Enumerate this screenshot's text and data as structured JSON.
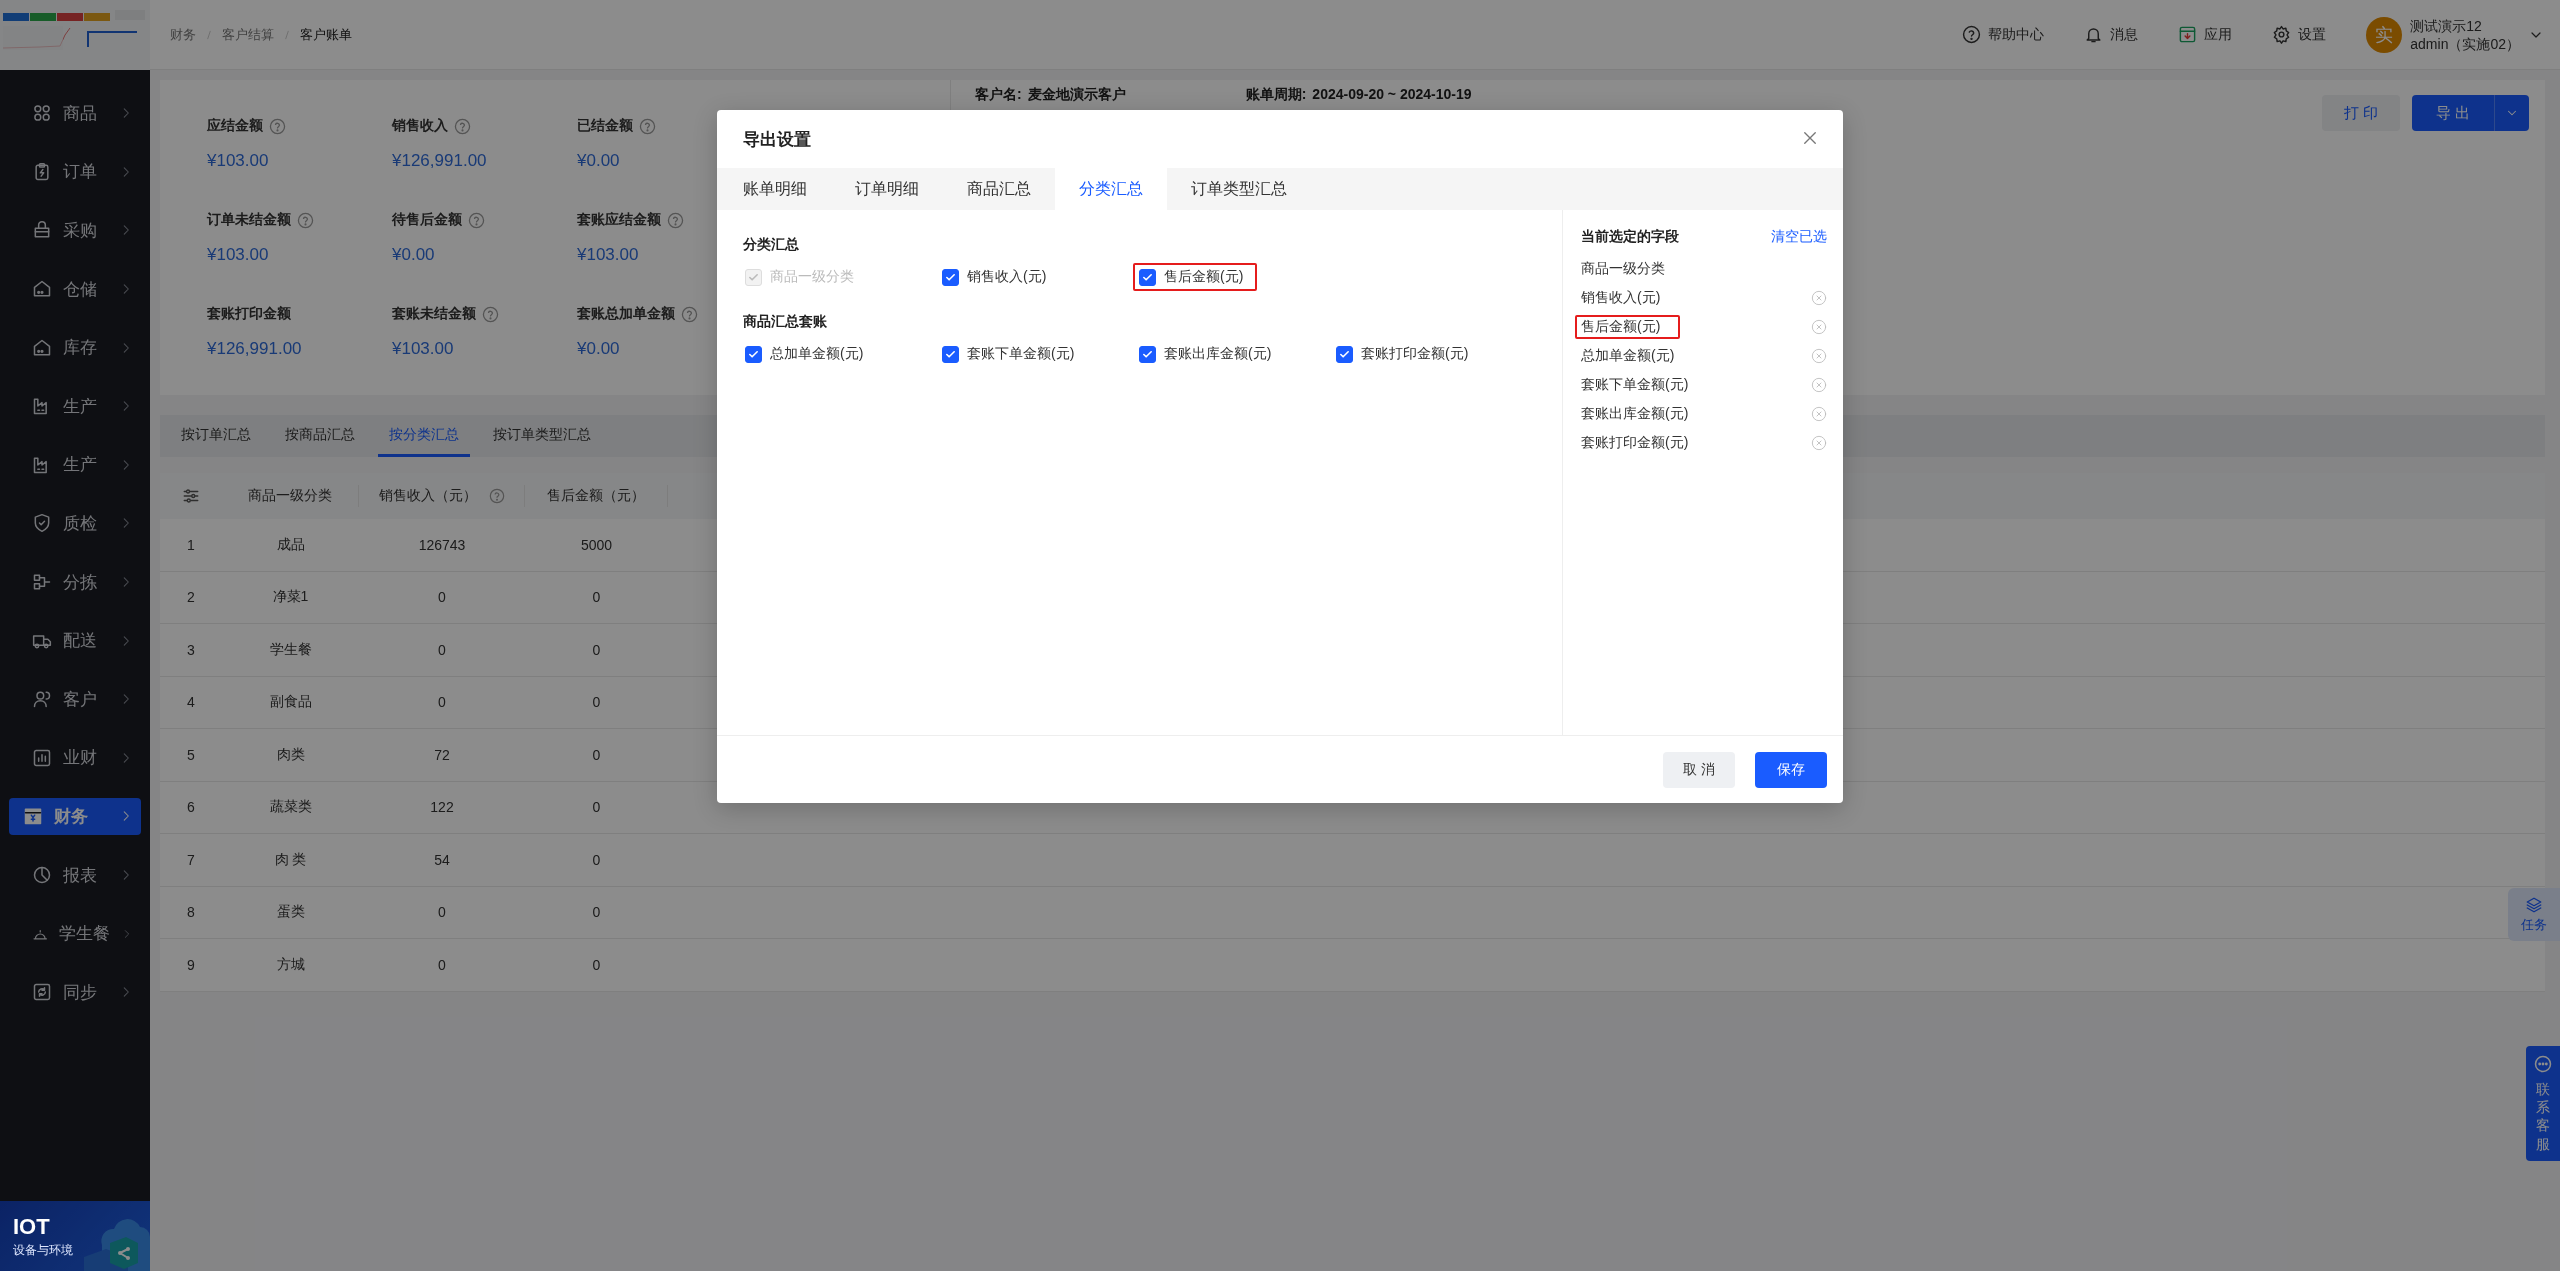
{
  "breadcrumb": [
    "财务",
    "客户结算",
    "客户账单"
  ],
  "header_actions": [
    "帮助中心",
    "消息",
    "应用",
    "设置"
  ],
  "user": {
    "avatar": "实",
    "name": "测试演示12",
    "account": "admin（实施02）"
  },
  "sidebar": {
    "items": [
      {
        "label": "商品",
        "selected": false
      },
      {
        "label": "订单",
        "selected": false
      },
      {
        "label": "采购",
        "selected": false
      },
      {
        "label": "仓储",
        "selected": false
      },
      {
        "label": "库存",
        "selected": false
      },
      {
        "label": "生产",
        "selected": false
      },
      {
        "label": "生产",
        "selected": false
      },
      {
        "label": "质检",
        "selected": false
      },
      {
        "label": "分拣",
        "selected": false
      },
      {
        "label": "配送",
        "selected": false
      },
      {
        "label": "客户",
        "selected": false
      },
      {
        "label": "业财",
        "selected": false
      },
      {
        "label": "财务",
        "selected": true
      },
      {
        "label": "报表",
        "selected": false
      },
      {
        "label": "学生餐",
        "selected": false
      },
      {
        "label": "同步",
        "selected": false
      }
    ],
    "banner": {
      "title": "IOT",
      "subtitle": "设备与环境"
    }
  },
  "summary": [
    {
      "label": "应结金额",
      "help": true,
      "value": "¥103.00"
    },
    {
      "label": "销售收入",
      "help": true,
      "value": "¥126,991.00"
    },
    {
      "label": "已结金额",
      "help": true,
      "value": "¥0.00"
    },
    {
      "label": "订单未结金额",
      "help": true,
      "value": "¥103.00"
    },
    {
      "label": "待售后金额",
      "help": true,
      "value": "¥0.00"
    },
    {
      "label": "套账应结金额",
      "help": true,
      "value": "¥103.00"
    },
    {
      "label": "套账打印金额",
      "help": false,
      "value": "¥126,991.00"
    },
    {
      "label": "套账未结金额",
      "help": true,
      "value": "¥103.00"
    },
    {
      "label": "套账总加单金额",
      "help": true,
      "value": "¥0.00"
    }
  ],
  "customer": [
    {
      "label": "客户名:",
      "value": "麦金地演示客户"
    },
    {
      "label": "账单周期:",
      "value": "2024-09-20 ~ 2024-10-19"
    }
  ],
  "actions": {
    "print": "打 印",
    "export": "导 出"
  },
  "tabs": [
    {
      "label": "按订单汇总",
      "selected": false
    },
    {
      "label": "按商品汇总",
      "selected": false
    },
    {
      "label": "按分类汇总",
      "selected": true
    },
    {
      "label": "按订单类型汇总",
      "selected": false
    }
  ],
  "table": {
    "columns": [
      {
        "kind": "settings"
      },
      {
        "kind": "text",
        "label": "商品一级分类",
        "help": false
      },
      {
        "kind": "text",
        "label": "销售收入（元）",
        "help": true
      },
      {
        "kind": "text",
        "label": "售后金额（元）",
        "help": false
      }
    ],
    "rows": [
      [
        "1",
        "成品",
        "126743",
        "5000"
      ],
      [
        "2",
        "净菜1",
        "0",
        "0"
      ],
      [
        "3",
        "学生餐",
        "0",
        "0"
      ],
      [
        "4",
        "副食品",
        "0",
        "0"
      ],
      [
        "5",
        "肉类",
        "72",
        "0"
      ],
      [
        "6",
        "蔬菜类",
        "122",
        "0"
      ],
      [
        "7",
        "肉 类",
        "54",
        "0"
      ],
      [
        "8",
        "蛋类",
        "0",
        "0"
      ],
      [
        "9",
        "方城",
        "0",
        "0"
      ]
    ]
  },
  "floating": {
    "task": "任务",
    "support": "联系客服"
  },
  "dialog": {
    "title": "导出设置",
    "tabs": [
      {
        "label": "账单明细",
        "selected": false
      },
      {
        "label": "订单明细",
        "selected": false
      },
      {
        "label": "商品汇总",
        "selected": false
      },
      {
        "label": "分类汇总",
        "selected": true
      },
      {
        "label": "订单类型汇总",
        "selected": false
      }
    ],
    "groups": [
      {
        "title": "分类汇总",
        "options": [
          {
            "label": "商品一级分类",
            "checked": true,
            "disabled": true,
            "highlighted": false
          },
          {
            "label": "销售收入(元)",
            "checked": true,
            "disabled": false,
            "highlighted": false
          },
          {
            "label": "售后金额(元)",
            "checked": true,
            "disabled": false,
            "highlighted": true
          }
        ]
      },
      {
        "title": "商品汇总套账",
        "options": [
          {
            "label": "总加单金额(元)",
            "checked": true,
            "disabled": false,
            "highlighted": false
          },
          {
            "label": "套账下单金额(元)",
            "checked": true,
            "disabled": false,
            "highlighted": false
          },
          {
            "label": "套账出库金额(元)",
            "checked": true,
            "disabled": false,
            "highlighted": false
          },
          {
            "label": "套账打印金额(元)",
            "checked": true,
            "disabled": false,
            "highlighted": false
          }
        ]
      }
    ],
    "selected_panel": {
      "title": "当前选定的字段",
      "clear": "清空已选",
      "fields": [
        {
          "label": "商品一级分类",
          "removable": false,
          "highlighted": false
        },
        {
          "label": "销售收入(元)",
          "removable": true,
          "highlighted": false
        },
        {
          "label": "售后金额(元)",
          "removable": true,
          "highlighted": true
        },
        {
          "label": "总加单金额(元)",
          "removable": true,
          "highlighted": false
        },
        {
          "label": "套账下单金额(元)",
          "removable": true,
          "highlighted": false
        },
        {
          "label": "套账出库金额(元)",
          "removable": true,
          "highlighted": false
        },
        {
          "label": "套账打印金额(元)",
          "removable": true,
          "highlighted": false
        }
      ]
    },
    "buttons": {
      "cancel": "取 消",
      "save": "保存"
    }
  }
}
